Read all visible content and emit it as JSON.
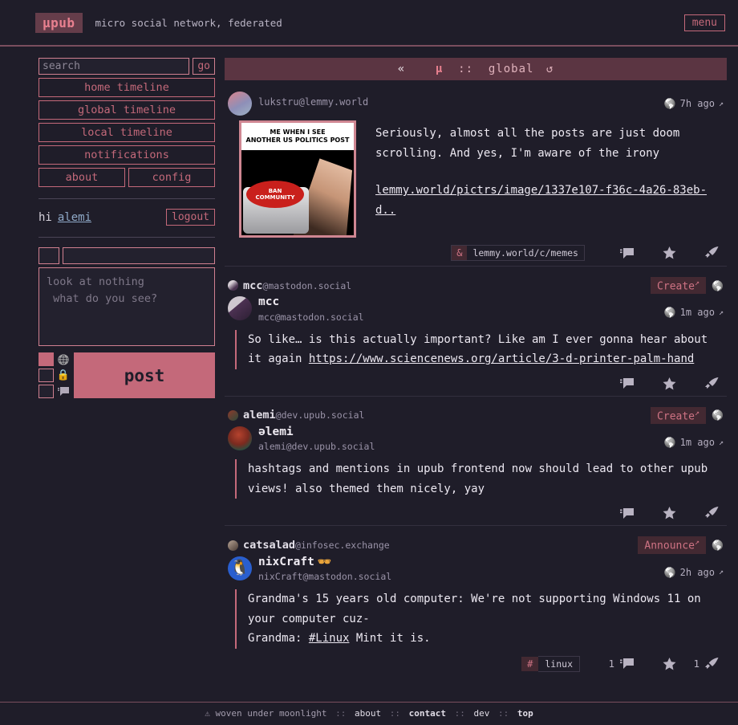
{
  "topbar": {
    "brand": "µpub",
    "tagline": "micro social network, federated",
    "menu_label": "menu"
  },
  "sidebar": {
    "search": {
      "placeholder": "search",
      "value": "",
      "go_label": "go"
    },
    "nav": [
      {
        "label": "home timeline"
      },
      {
        "label": "global timeline"
      },
      {
        "label": "local timeline"
      },
      {
        "label": "notifications"
      }
    ],
    "nav_pair": [
      {
        "label": "about"
      },
      {
        "label": "config"
      }
    ],
    "user": {
      "hi": "hi",
      "name": "alemi",
      "logout_label": "logout"
    },
    "compose": {
      "title_value": "",
      "title_placeholder": "",
      "body_placeholder": "look at nothing\n what do you see?",
      "body_value": "",
      "post_label": "post",
      "options": [
        {
          "icon": "globe-icon",
          "glyph": "🌐",
          "checked": true
        },
        {
          "icon": "lock-icon",
          "glyph": "🔒",
          "checked": false
        },
        {
          "icon": "speech-bubble-icon",
          "glyph": "🗪",
          "checked": false
        }
      ]
    }
  },
  "timeline": {
    "header": {
      "back": "«",
      "mu": "µ",
      "sep": "::",
      "name": "global",
      "reload": "↺"
    },
    "posts": [
      {
        "id": "post-lukstru",
        "activity": null,
        "avatar_class": "av-luk",
        "display_name": "",
        "show_display_name": false,
        "handle": "lukstru@lemmy.world",
        "verified": false,
        "timestamp": "7h ago",
        "visibility_icon": "globe-icon",
        "has_image": true,
        "image": {
          "caption_line1": "ME WHEN I SEE",
          "caption_line2": "ANOTHER US POLITICS POST",
          "button_line1": "BAN",
          "button_line2": "COMMUNITY"
        },
        "body": "Seriously, almost all the posts are just doom scrolling. And yes, I'm aware of the irony",
        "link_text": "lemmy.world/pictrs/image/1337e107-f36c-4a26-83eb-d..",
        "source_pill": {
          "symbol": "&",
          "label": "lemmy.world/c/memes"
        },
        "tag": null,
        "reply_count": "",
        "like_count": "",
        "boost_count": ""
      },
      {
        "id": "post-mcc",
        "activity": {
          "avatar_class": "mcc",
          "name": "mcc",
          "domain": "@mastodon.social",
          "action": "Create",
          "visibility_icon": "globe-icon"
        },
        "avatar_class": "av-mcc",
        "display_name": "mcc",
        "show_display_name": true,
        "handle": "mcc@mastodon.social",
        "verified": false,
        "timestamp": "1m ago",
        "visibility_icon": "globe-icon",
        "has_image": false,
        "body_pre": "So like… is this actually important? Like am I ever gonna hear about it again ",
        "body_link": "https://www.sciencenews.org/article/3-d-printer-palm-hand",
        "body_post": "",
        "source_pill": null,
        "tag": null,
        "reply_count": "",
        "like_count": "",
        "boost_count": ""
      },
      {
        "id": "post-alemi",
        "activity": {
          "avatar_class": "alemi",
          "name": "alemi",
          "domain": "@dev.upub.social",
          "action": "Create",
          "visibility_icon": "globe-icon"
        },
        "avatar_class": "av-alemi",
        "display_name": "əlemi",
        "show_display_name": true,
        "handle": "alemi@dev.upub.social",
        "verified": false,
        "timestamp": "1m ago",
        "visibility_icon": "globe-icon",
        "has_image": false,
        "body_pre": "hashtags and mentions in upub frontend now should lead to other upub views! also themed them nicely, yay",
        "body_link": "",
        "body_post": "",
        "source_pill": null,
        "tag": null,
        "reply_count": "",
        "like_count": "",
        "boost_count": ""
      },
      {
        "id": "post-nixcraft",
        "activity": {
          "avatar_class": "cats",
          "name": "catsalad",
          "domain": "@infosec.exchange",
          "action": "Announce",
          "visibility_icon": "globe-icon"
        },
        "avatar_class": "av-nix",
        "display_name": "nixCraft",
        "show_display_name": true,
        "verified": true,
        "verified_glyph": "🕶",
        "handle": "nixCraft@mastodon.social",
        "timestamp": "2h ago",
        "visibility_icon": "globe-icon",
        "has_image": false,
        "body_pre": "Grandma's 15 years old computer: We're not supporting Windows 11 on your computer cuz-\nGrandma: ",
        "body_tag": "#Linux",
        "body_post": " Mint it is.",
        "source_pill": null,
        "tag": {
          "hash": "#",
          "label": "linux"
        },
        "reply_count": "1",
        "like_count": "",
        "boost_count": "1"
      }
    ]
  },
  "footer": {
    "triangle": "⚠",
    "motto": "woven under moonlight",
    "links": [
      "about",
      "contact",
      "dev",
      "top"
    ],
    "separator": "::"
  },
  "colors": {
    "background": "#1f1d29",
    "accent": "#c4697a",
    "accent_bright": "#e8808f",
    "header_bar": "#5b3542",
    "pill": "#432932",
    "muted_text": "#9a93a8",
    "link_blue": "#8fa9c8"
  }
}
